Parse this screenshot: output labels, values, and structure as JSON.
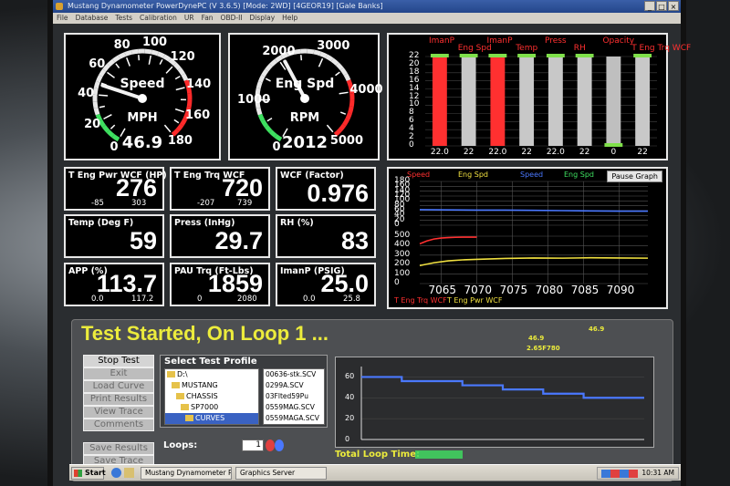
{
  "window": {
    "title": "Mustang Dynamometer PowerDynePC (V 3.6.5) [Mode: 2WD] [4GEOR19] [Gale Banks]",
    "menu": [
      "File",
      "Database",
      "Tests",
      "Calibration",
      "UR",
      "Fan",
      "OBD-II",
      "Display",
      "Help"
    ]
  },
  "gauges": [
    {
      "name": "Speed",
      "unit": "MPH",
      "value": "46.9",
      "ticks": [
        "0",
        "20",
        "40",
        "60",
        "80",
        "100",
        "120",
        "140",
        "160",
        "180"
      ]
    },
    {
      "name": "Eng Spd",
      "unit": "RPM",
      "value": "2012",
      "ticks": [
        "0",
        "1000",
        "2000",
        "3000",
        "4000",
        "5000"
      ]
    }
  ],
  "readouts": [
    {
      "label": "T Eng Pwr WCF (HP)",
      "value": "276",
      "min": "-85",
      "max": "303"
    },
    {
      "label": "T Eng Trq WCF",
      "value": "720",
      "min": "-207",
      "max": "739"
    },
    {
      "label": "WCF (Factor)",
      "value": "0.976",
      "min": "",
      "max": ""
    },
    {
      "label": "Temp (Deg F)",
      "value": "59",
      "min": "",
      "max": ""
    },
    {
      "label": "Press (InHg)",
      "value": "29.7",
      "min": "",
      "max": ""
    },
    {
      "label": "RH (%)",
      "value": "83",
      "min": "",
      "max": ""
    },
    {
      "label": "APP (%)",
      "value": "113.7",
      "min": "0.0",
      "max": "117.2"
    },
    {
      "label": "PAU Trq (Ft-Lbs)",
      "value": "1859",
      "min": "0",
      "max": "2080"
    },
    {
      "label": "ImanP (PSIG)",
      "value": "25.0",
      "min": "0.0",
      "max": "25.8"
    }
  ],
  "chart_data": [
    {
      "type": "bar",
      "categories": [
        "ImanP",
        "Eng Spd",
        "ImanP",
        "Temp",
        "Press",
        "RH",
        "Opacity",
        "T Eng Trq WCF"
      ],
      "header_colors": [
        "#ff3030",
        "#ff3030",
        "#ff3030",
        "#ff3030",
        "#ff3030",
        "#ff3030",
        "#ff3030",
        "#ff3030"
      ],
      "values": [
        22.0,
        22,
        22.0,
        22,
        22.0,
        22,
        0,
        22
      ],
      "value_labels": [
        "22.0",
        "22",
        "22.0",
        "22",
        "22.0",
        "22",
        "0",
        "22"
      ],
      "bar_colors": [
        "#ff3030",
        "#c8c8c8",
        "#ff3030",
        "#c8c8c8",
        "#c8c8c8",
        "#c8c8c8",
        "#c8c8c8",
        "#c8c8c8"
      ],
      "cap_color": "#7fe04a",
      "ylim": [
        0,
        22
      ],
      "yticks": [
        "0",
        "2",
        "4",
        "6",
        "8",
        "10",
        "12",
        "14",
        "16",
        "18",
        "20",
        "22"
      ]
    },
    {
      "type": "line",
      "legend": [
        {
          "name": "Speed",
          "color": "#ff3030"
        },
        {
          "name": "Eng Spd",
          "color": "#f0e040"
        },
        {
          "name": "Speed",
          "color": "#4a78ff"
        },
        {
          "name": "Eng Spd",
          "color": "#3ee060"
        }
      ],
      "legend_bottom": [
        {
          "name": "T Eng Trq WCF",
          "color": "#ff3030"
        },
        {
          "name": "T Eng Pwr WCF",
          "color": "#f0e040"
        }
      ],
      "pause_label": "Pause Graph",
      "x_ticks": [
        "7065",
        "7070",
        "7075",
        "7080",
        "7085",
        "7090"
      ],
      "xlim": [
        7062,
        7094
      ],
      "upper_yticks": [
        "0",
        "20",
        "40",
        "60",
        "80",
        "100",
        "120",
        "140",
        "160",
        "180"
      ],
      "upper_ylim": [
        0,
        180
      ],
      "lower_yticks": [
        "0",
        "100",
        "200",
        "300",
        "400",
        "500"
      ],
      "lower_ylim": [
        0,
        500
      ],
      "series": [
        {
          "name": "Speed",
          "panel": "upper",
          "color": "#4a78ff",
          "x": [
            7062,
            7066,
            7070,
            7074,
            7078,
            7082,
            7086,
            7090,
            7094
          ],
          "y": [
            64,
            63,
            62,
            62,
            61,
            60,
            59,
            58,
            58
          ]
        },
        {
          "name": "T Eng Trq WCF",
          "panel": "lower",
          "color": "#ff3030",
          "x": [
            7062,
            7063,
            7064,
            7065,
            7066,
            7067,
            7068,
            7069,
            7070
          ],
          "y": [
            420,
            450,
            470,
            480,
            485,
            488,
            490,
            490,
            490
          ]
        },
        {
          "name": "T Eng Pwr WCF",
          "panel": "lower",
          "color": "#f0e040",
          "x": [
            7062,
            7064,
            7066,
            7068,
            7070,
            7074,
            7078,
            7082,
            7086,
            7090,
            7094
          ],
          "y": [
            190,
            220,
            240,
            250,
            255,
            265,
            270,
            268,
            272,
            270,
            268
          ]
        }
      ]
    },
    {
      "type": "line",
      "yticks": [
        "0",
        "20",
        "40",
        "60"
      ],
      "ylim": [
        0,
        70
      ],
      "xlim": [
        0,
        14
      ],
      "series": [
        {
          "color": "#4a78ff",
          "x": [
            0,
            2,
            2,
            5,
            5,
            7,
            7,
            9,
            9,
            11,
            11,
            14
          ],
          "y": [
            60,
            60,
            56,
            56,
            52,
            52,
            48,
            48,
            44,
            44,
            40,
            40
          ]
        }
      ]
    }
  ],
  "test": {
    "headline": "Test Started, On Loop 1 ...",
    "small1": "46.9",
    "small2": "2.65F780",
    "small3": "46.9",
    "buttons": [
      "Stop Test",
      "Exit",
      "Load Curve",
      "Print Results",
      "View Trace",
      "Comments",
      "Save Results",
      "Save Trace"
    ],
    "profile_title": "Select Test Profile",
    "tree": [
      "D:\\",
      "MUSTANG",
      "CHASSIS",
      "SP7000",
      "CURVES"
    ],
    "files": [
      "00636-stk.SCV",
      "0299A.SCV",
      "03Flted59Pu",
      "0559MAG.SCV",
      "0559MAGA.SCV",
      "05LLY.SCV"
    ],
    "loops_label": "Loops:",
    "loops_value": "1",
    "total_loop_label": "Total Loop Time:"
  },
  "taskbar": {
    "start": "Start",
    "task1": "Mustang Dynamometer P...",
    "task2": "Graphics Server",
    "clock": "10:31 AM"
  }
}
